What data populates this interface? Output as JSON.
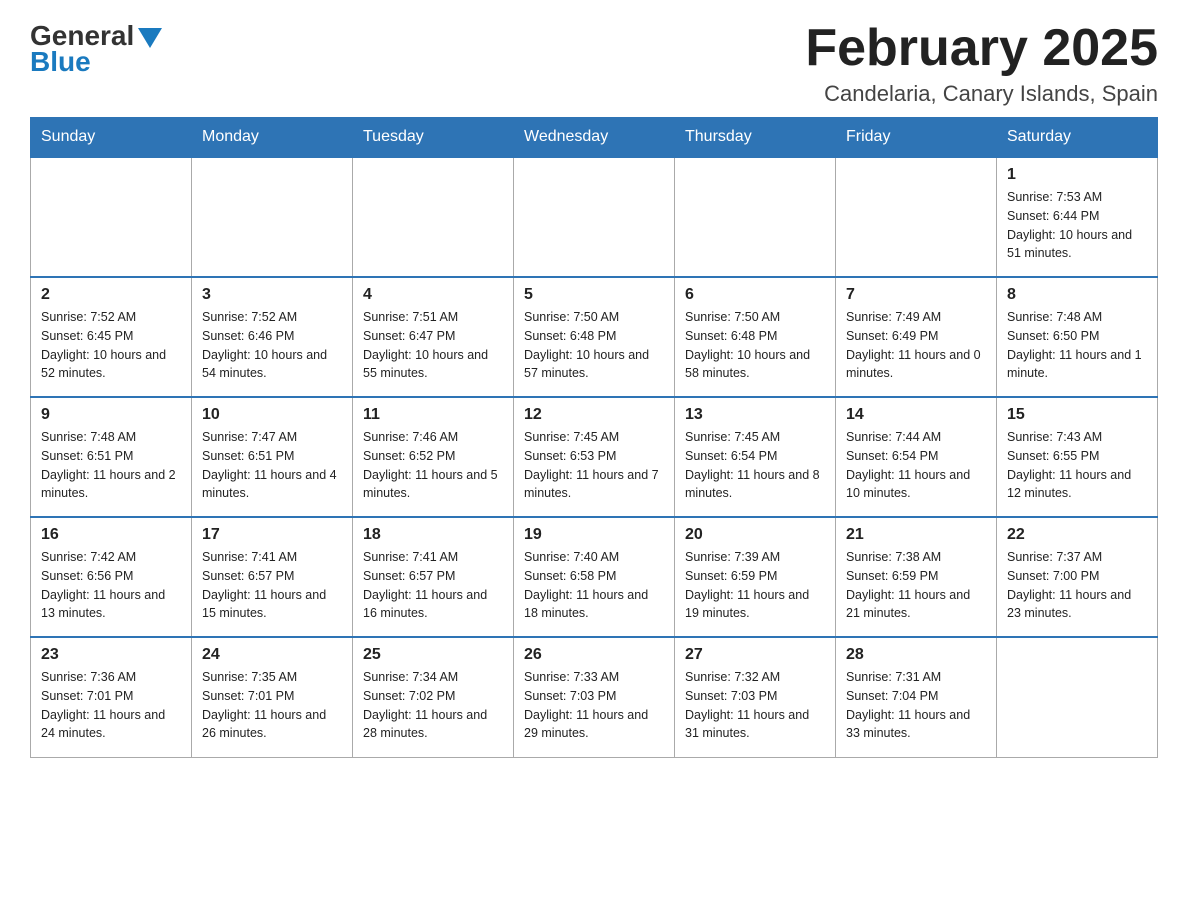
{
  "header": {
    "logo_general": "General",
    "logo_blue": "Blue",
    "title": "February 2025",
    "subtitle": "Candelaria, Canary Islands, Spain"
  },
  "days_of_week": [
    "Sunday",
    "Monday",
    "Tuesday",
    "Wednesday",
    "Thursday",
    "Friday",
    "Saturday"
  ],
  "weeks": [
    [
      {
        "day": "",
        "info": ""
      },
      {
        "day": "",
        "info": ""
      },
      {
        "day": "",
        "info": ""
      },
      {
        "day": "",
        "info": ""
      },
      {
        "day": "",
        "info": ""
      },
      {
        "day": "",
        "info": ""
      },
      {
        "day": "1",
        "info": "Sunrise: 7:53 AM\nSunset: 6:44 PM\nDaylight: 10 hours and 51 minutes."
      }
    ],
    [
      {
        "day": "2",
        "info": "Sunrise: 7:52 AM\nSunset: 6:45 PM\nDaylight: 10 hours and 52 minutes."
      },
      {
        "day": "3",
        "info": "Sunrise: 7:52 AM\nSunset: 6:46 PM\nDaylight: 10 hours and 54 minutes."
      },
      {
        "day": "4",
        "info": "Sunrise: 7:51 AM\nSunset: 6:47 PM\nDaylight: 10 hours and 55 minutes."
      },
      {
        "day": "5",
        "info": "Sunrise: 7:50 AM\nSunset: 6:48 PM\nDaylight: 10 hours and 57 minutes."
      },
      {
        "day": "6",
        "info": "Sunrise: 7:50 AM\nSunset: 6:48 PM\nDaylight: 10 hours and 58 minutes."
      },
      {
        "day": "7",
        "info": "Sunrise: 7:49 AM\nSunset: 6:49 PM\nDaylight: 11 hours and 0 minutes."
      },
      {
        "day": "8",
        "info": "Sunrise: 7:48 AM\nSunset: 6:50 PM\nDaylight: 11 hours and 1 minute."
      }
    ],
    [
      {
        "day": "9",
        "info": "Sunrise: 7:48 AM\nSunset: 6:51 PM\nDaylight: 11 hours and 2 minutes."
      },
      {
        "day": "10",
        "info": "Sunrise: 7:47 AM\nSunset: 6:51 PM\nDaylight: 11 hours and 4 minutes."
      },
      {
        "day": "11",
        "info": "Sunrise: 7:46 AM\nSunset: 6:52 PM\nDaylight: 11 hours and 5 minutes."
      },
      {
        "day": "12",
        "info": "Sunrise: 7:45 AM\nSunset: 6:53 PM\nDaylight: 11 hours and 7 minutes."
      },
      {
        "day": "13",
        "info": "Sunrise: 7:45 AM\nSunset: 6:54 PM\nDaylight: 11 hours and 8 minutes."
      },
      {
        "day": "14",
        "info": "Sunrise: 7:44 AM\nSunset: 6:54 PM\nDaylight: 11 hours and 10 minutes."
      },
      {
        "day": "15",
        "info": "Sunrise: 7:43 AM\nSunset: 6:55 PM\nDaylight: 11 hours and 12 minutes."
      }
    ],
    [
      {
        "day": "16",
        "info": "Sunrise: 7:42 AM\nSunset: 6:56 PM\nDaylight: 11 hours and 13 minutes."
      },
      {
        "day": "17",
        "info": "Sunrise: 7:41 AM\nSunset: 6:57 PM\nDaylight: 11 hours and 15 minutes."
      },
      {
        "day": "18",
        "info": "Sunrise: 7:41 AM\nSunset: 6:57 PM\nDaylight: 11 hours and 16 minutes."
      },
      {
        "day": "19",
        "info": "Sunrise: 7:40 AM\nSunset: 6:58 PM\nDaylight: 11 hours and 18 minutes."
      },
      {
        "day": "20",
        "info": "Sunrise: 7:39 AM\nSunset: 6:59 PM\nDaylight: 11 hours and 19 minutes."
      },
      {
        "day": "21",
        "info": "Sunrise: 7:38 AM\nSunset: 6:59 PM\nDaylight: 11 hours and 21 minutes."
      },
      {
        "day": "22",
        "info": "Sunrise: 7:37 AM\nSunset: 7:00 PM\nDaylight: 11 hours and 23 minutes."
      }
    ],
    [
      {
        "day": "23",
        "info": "Sunrise: 7:36 AM\nSunset: 7:01 PM\nDaylight: 11 hours and 24 minutes."
      },
      {
        "day": "24",
        "info": "Sunrise: 7:35 AM\nSunset: 7:01 PM\nDaylight: 11 hours and 26 minutes."
      },
      {
        "day": "25",
        "info": "Sunrise: 7:34 AM\nSunset: 7:02 PM\nDaylight: 11 hours and 28 minutes."
      },
      {
        "day": "26",
        "info": "Sunrise: 7:33 AM\nSunset: 7:03 PM\nDaylight: 11 hours and 29 minutes."
      },
      {
        "day": "27",
        "info": "Sunrise: 7:32 AM\nSunset: 7:03 PM\nDaylight: 11 hours and 31 minutes."
      },
      {
        "day": "28",
        "info": "Sunrise: 7:31 AM\nSunset: 7:04 PM\nDaylight: 11 hours and 33 minutes."
      },
      {
        "day": "",
        "info": ""
      }
    ]
  ]
}
